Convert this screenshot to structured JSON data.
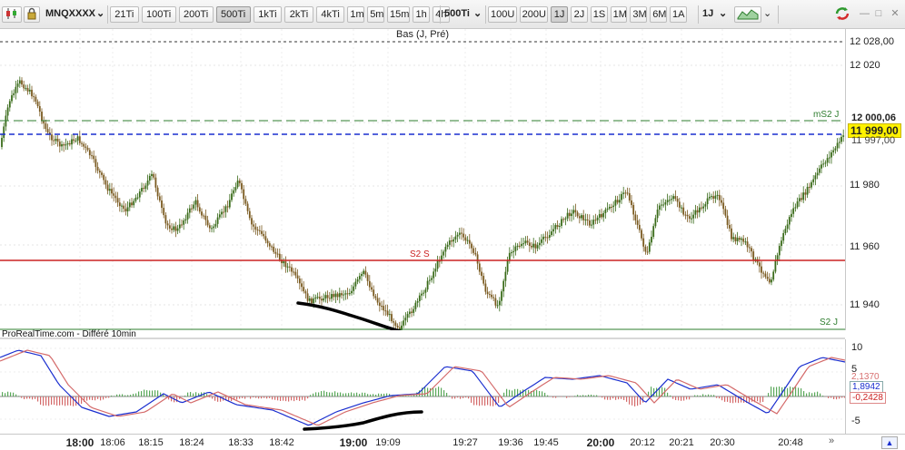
{
  "toolbar": {
    "symbol": "MNQXXXX",
    "tick_buttons": [
      "21Ti",
      "100Ti",
      "200Ti",
      "500Ti",
      "1kTi",
      "2kTi",
      "4kTi",
      "1m",
      "5m",
      "15m",
      "1h",
      "4h"
    ],
    "active_tick": "500Ti",
    "interval_select": "500Ti",
    "unit_buttons": [
      "100U",
      "200U",
      "1J",
      "2J",
      "1S",
      "1M",
      "3M",
      "6M",
      "1A"
    ],
    "active_unit": "1J",
    "period_select": "1J"
  },
  "chart": {
    "indicator_label": "Bas (J, Pré)",
    "price_ticks": [
      "12 028,00",
      "12 020",
      "12 000,06",
      "11 997,00",
      "11 980",
      "11 960",
      "11 940"
    ],
    "current_price": "11 999,00",
    "ms2_label": "mS2 J",
    "s2s_label": "S2 S",
    "s2j_label": "S2 J",
    "source_label": "ProRealTime.com - Différé 10min",
    "colors": {
      "up": "#3a6b1a",
      "down": "#7a5a20",
      "blue_line": "#1a2ecf",
      "red_line": "#cc2222",
      "green_line": "#2e7d2e"
    }
  },
  "indicator": {
    "axis_ticks": [
      "10",
      "5",
      "0",
      "-5"
    ],
    "value_1": "1,8942",
    "value_2": "-0,2428",
    "value_3": "2,1370"
  },
  "time_axis": {
    "labels": [
      "18:00",
      "18:06",
      "18:15",
      "18:24",
      "18:33",
      "18:42",
      "19:00",
      "19:09",
      "19:27",
      "19:36",
      "19:45",
      "20:00",
      "20:12",
      "20:21",
      "20:30",
      "20:48"
    ],
    "major": [
      "18:00",
      "19:00",
      "20:00"
    ]
  }
}
